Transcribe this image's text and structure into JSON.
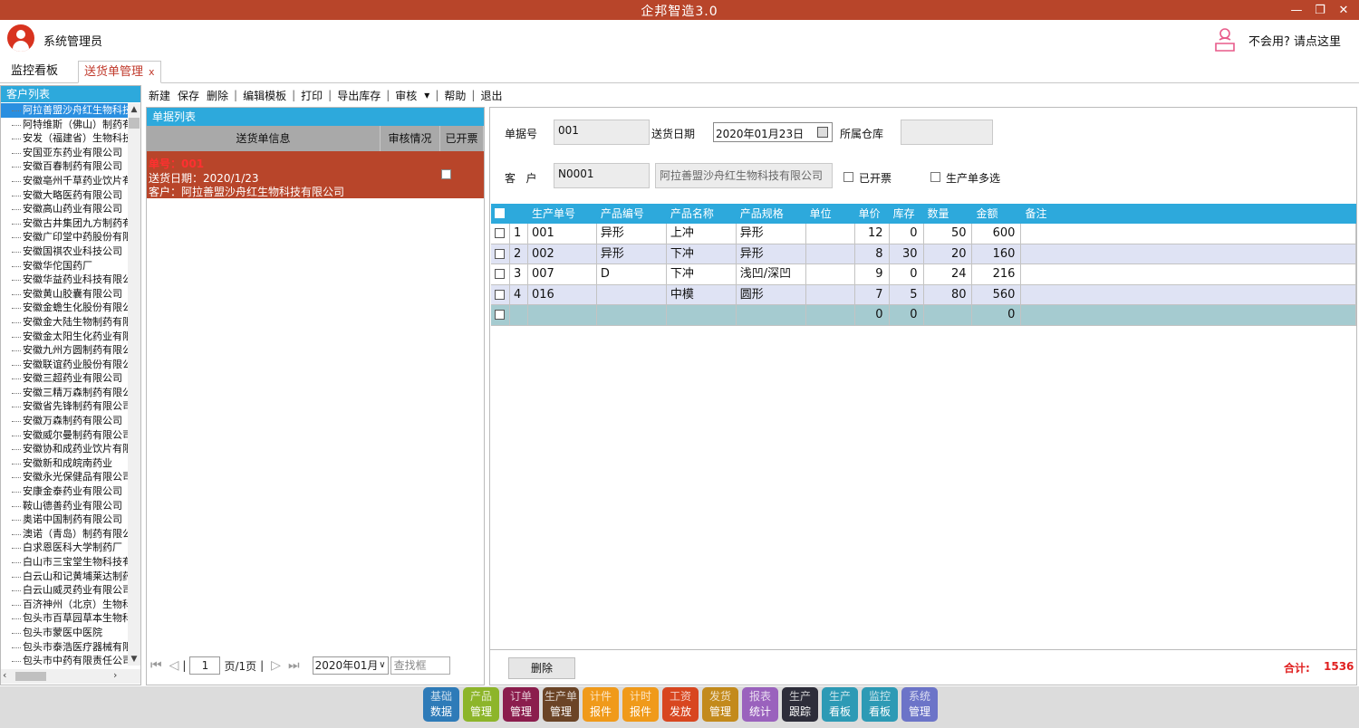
{
  "window": {
    "title": "企邦智造3.0",
    "minimize": "—",
    "restore": "❐",
    "close": "✕"
  },
  "user": {
    "name": "系统管理员",
    "help_text": "不会用? 请点这里"
  },
  "tabs": [
    {
      "label": "监控看板"
    },
    {
      "label": "送货单管理",
      "close": "x"
    }
  ],
  "customer_panel": {
    "title": "客户列表",
    "items": [
      "阿拉善盟沙舟红生物科技有限公司",
      "阿特维斯（佛山）制药有限公司",
      "安发（福建省）生物科技有限公司",
      "安国亚东药业有限公司",
      "安徽百春制药有限公司",
      "安徽亳州千草药业饮片有限公司",
      "安徽大略医药有限公司",
      "安徽高山药业有限公司",
      "安徽古井集团九方制药有限公司",
      "安徽广印堂中药股份有限公司",
      "安徽国祺农业科技公司",
      "安徽华佗国药厂",
      "安徽华益药业科技有限公司",
      "安徽黄山胶囊有限公司",
      "安徽金蟾生化股份有限公司",
      "安徽金大陆生物制药有限公司",
      "安徽金太阳生化药业有限公司",
      "安徽九州方圆制药有限公司",
      "安徽联谊药业股份有限公司",
      "安徽三超药业有限公司",
      "安徽三精万森制药有限公司",
      "安徽省先锋制药有限公司",
      "安徽万森制药有限公司",
      "安徽威尔曼制药有限公司",
      "安徽协和成药业饮片有限公司",
      "安徽新和成皖南药业",
      "安徽永光保健品有限公司",
      "安康金泰药业有限公司",
      "鞍山德善药业有限公司",
      "奥诺中国制药有限公司",
      "澳诺（青岛）制药有限公司",
      "白求恩医科大学制药厂",
      "白山市三宝堂生物科技有限公司",
      "白云山和记黄埔莱达制药",
      "白云山威灵药业有限公司",
      "百济神州（北京）生物科技",
      "包头市百草园草本生物科技",
      "包头市蒙医中医院",
      "包头市泰浩医疗器械有限公司",
      "包头市中药有限责任公司"
    ]
  },
  "toolbar": {
    "items": [
      "新建",
      "保存",
      "删除",
      "编辑模板",
      "打印",
      "导出库存",
      "审核",
      "帮助",
      "退出"
    ],
    "dropdown_glyph": "▾"
  },
  "list_panel": {
    "title": "单据列表",
    "columns": [
      "送货单信息",
      "审核情况",
      "已开票"
    ],
    "rows": [
      {
        "line1": "单号：001",
        "line2": "送货日期：2020/1/23",
        "line3": "客户：阿拉善盟沙舟红生物科技有限公司"
      }
    ],
    "pager": {
      "page": "1",
      "total": "页/1页",
      "month": "2020年01月",
      "search_placeholder": "查找框"
    }
  },
  "form": {
    "doc_no_label": "单据号",
    "doc_no": "001",
    "date_label": "送货日期",
    "date": "2020年01月23日",
    "warehouse_label": "所属仓库",
    "warehouse": "",
    "customer_label": "客   户",
    "customer_code": "N0001",
    "customer_name": "阿拉善盟沙舟红生物科技有限公司",
    "invoiced_label": "已开票",
    "multi_label": "生产单多选"
  },
  "grid": {
    "columns": [
      "生产单号",
      "产品编号",
      "产品名称",
      "产品规格",
      "单位",
      "单价",
      "库存",
      "数量",
      "金额",
      "备注"
    ],
    "rows": [
      {
        "idx": "1",
        "order": "001",
        "code": "异形",
        "name": "上冲",
        "spec": "异形",
        "unit": "",
        "price": "12",
        "stock": "0",
        "qty": "50",
        "amount": "600",
        "note": ""
      },
      {
        "idx": "2",
        "order": "002",
        "code": "异形",
        "name": "下冲",
        "spec": "异形",
        "unit": "",
        "price": "8",
        "stock": "30",
        "qty": "20",
        "amount": "160",
        "note": ""
      },
      {
        "idx": "3",
        "order": "007",
        "code": "D",
        "name": "下冲",
        "spec": "浅凹/深凹",
        "unit": "",
        "price": "9",
        "stock": "0",
        "qty": "24",
        "amount": "216",
        "note": ""
      },
      {
        "idx": "4",
        "order": "016",
        "code": "",
        "name": "中模",
        "spec": "圆形",
        "unit": "",
        "price": "7",
        "stock": "5",
        "qty": "80",
        "amount": "560",
        "note": ""
      }
    ],
    "total_row": {
      "price": "0",
      "stock": "0",
      "amount": "0"
    }
  },
  "footer": {
    "delete_label": "删除",
    "sum_label": "合计:",
    "sum_value": "1536"
  },
  "bottom_nav": [
    {
      "top": "基础",
      "bottom": "数据",
      "color": "#2e7bb8"
    },
    {
      "top": "产品",
      "bottom": "管理",
      "color": "#8db52a"
    },
    {
      "top": "订单",
      "bottom": "管理",
      "color": "#8b1d4d"
    },
    {
      "top": "生产单",
      "bottom": "管理",
      "color": "#6b4426"
    },
    {
      "top": "计件",
      "bottom": "报件",
      "color": "#f09a1a"
    },
    {
      "top": "计时",
      "bottom": "报件",
      "color": "#f09a1a"
    },
    {
      "top": "工资",
      "bottom": "发放",
      "color": "#d8461f"
    },
    {
      "top": "发货",
      "bottom": "管理",
      "color": "#c38a1c"
    },
    {
      "top": "报表",
      "bottom": "统计",
      "color": "#9a62bd"
    },
    {
      "top": "生产",
      "bottom": "跟踪",
      "color": "#2d2d3a"
    },
    {
      "top": "生产",
      "bottom": "看板",
      "color": "#2d9ab5"
    },
    {
      "top": "监控",
      "bottom": "看板",
      "color": "#2d9ab5"
    },
    {
      "top": "系统",
      "bottom": "管理",
      "color": "#6c74c8"
    }
  ]
}
